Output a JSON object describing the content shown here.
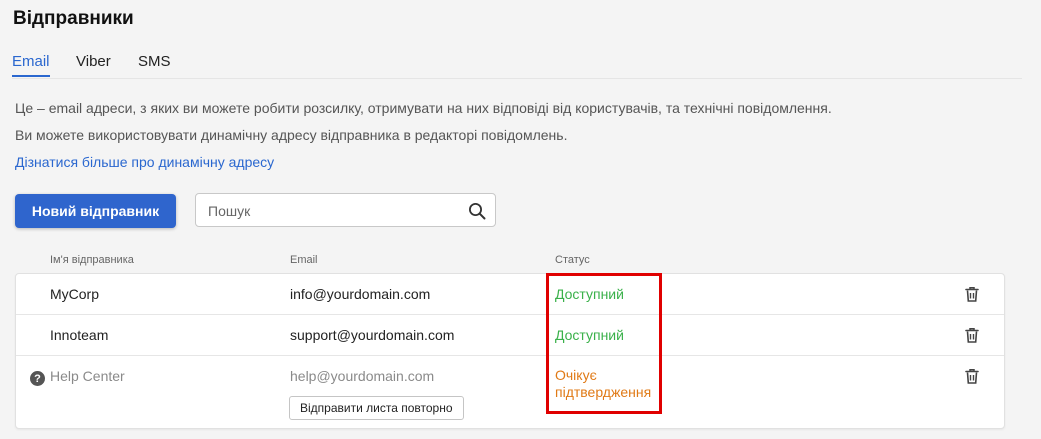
{
  "page": {
    "title": "Відправники"
  },
  "tabs": [
    {
      "label": "Email",
      "active": true
    },
    {
      "label": "Viber",
      "active": false
    },
    {
      "label": "SMS",
      "active": false
    }
  ],
  "description": {
    "line1": "Це – email адреси, з яких ви можете робити розсилку, отримувати на них відповіді від користувачів, та технічні повідомлення.",
    "line2": "Ви можете використовувати динамічну адресу відправника в редакторі повідомлень.",
    "link": "Дізнатися більше про динамічну адресу"
  },
  "toolbar": {
    "new_sender_label": "Новий відправник",
    "search_placeholder": "Пошук",
    "search_icon": "search-icon"
  },
  "table": {
    "headers": {
      "name": "Ім'я відправника",
      "email": "Email",
      "status": "Статус"
    },
    "rows": [
      {
        "name": "MyCorp",
        "email": "info@yourdomain.com",
        "status": "Доступний",
        "status_type": "ok",
        "action_icon": "trash-icon"
      },
      {
        "name": "Innoteam",
        "email": "support@yourdomain.com",
        "status": "Доступний",
        "status_type": "ok",
        "action_icon": "trash-icon"
      },
      {
        "name": "Help Center",
        "email": "help@yourdomain.com",
        "status_line1": "Очікує",
        "status_line2": "підтвердження",
        "status_type": "pending",
        "resend_label": "Відправити листа повторно",
        "help_icon": "question-circle-icon",
        "action_icon": "trash-icon"
      }
    ]
  },
  "colors": {
    "accent": "#2a67cf",
    "primary_button": "#2f65cd",
    "status_ok": "#3ab14a",
    "status_pending": "#e07a16",
    "highlight": "#e00000"
  }
}
